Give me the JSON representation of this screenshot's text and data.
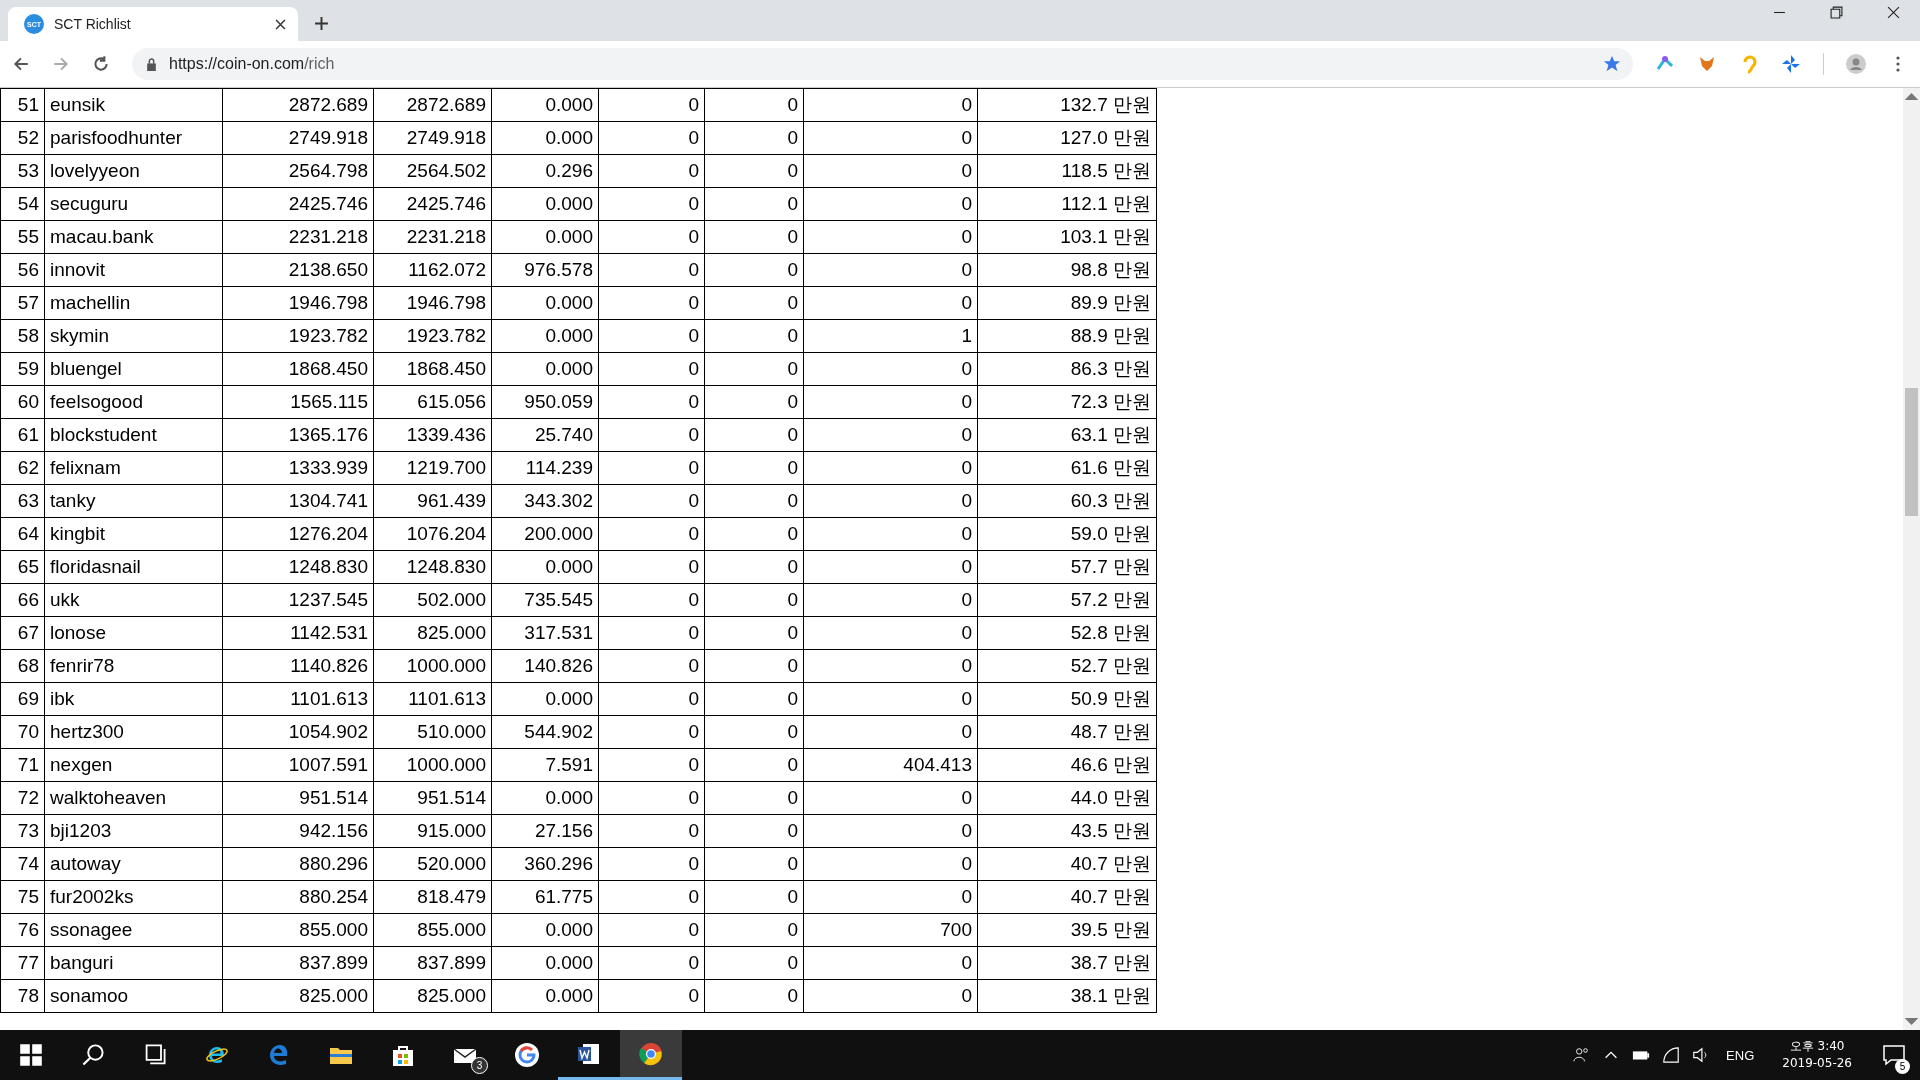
{
  "browser": {
    "tab_title": "SCT Richlist",
    "favicon_text": "SCT",
    "url_host": "https://coin-on.com",
    "url_path": "/rich"
  },
  "table": {
    "rows": [
      [
        "51",
        "eunsik",
        "2872.689",
        "2872.689",
        "0.000",
        "0",
        "0",
        "0",
        "132.7 만원"
      ],
      [
        "52",
        "parisfoodhunter",
        "2749.918",
        "2749.918",
        "0.000",
        "0",
        "0",
        "0",
        "127.0 만원"
      ],
      [
        "53",
        "lovelyyeon",
        "2564.798",
        "2564.502",
        "0.296",
        "0",
        "0",
        "0",
        "118.5 만원"
      ],
      [
        "54",
        "secuguru",
        "2425.746",
        "2425.746",
        "0.000",
        "0",
        "0",
        "0",
        "112.1 만원"
      ],
      [
        "55",
        "macau.bank",
        "2231.218",
        "2231.218",
        "0.000",
        "0",
        "0",
        "0",
        "103.1 만원"
      ],
      [
        "56",
        "innovit",
        "2138.650",
        "1162.072",
        "976.578",
        "0",
        "0",
        "0",
        "98.8 만원"
      ],
      [
        "57",
        "machellin",
        "1946.798",
        "1946.798",
        "0.000",
        "0",
        "0",
        "0",
        "89.9 만원"
      ],
      [
        "58",
        "skymin",
        "1923.782",
        "1923.782",
        "0.000",
        "0",
        "0",
        "1",
        "88.9 만원"
      ],
      [
        "59",
        "bluengel",
        "1868.450",
        "1868.450",
        "0.000",
        "0",
        "0",
        "0",
        "86.3 만원"
      ],
      [
        "60",
        "feelsogood",
        "1565.115",
        "615.056",
        "950.059",
        "0",
        "0",
        "0",
        "72.3 만원"
      ],
      [
        "61",
        "blockstudent",
        "1365.176",
        "1339.436",
        "25.740",
        "0",
        "0",
        "0",
        "63.1 만원"
      ],
      [
        "62",
        "felixnam",
        "1333.939",
        "1219.700",
        "114.239",
        "0",
        "0",
        "0",
        "61.6 만원"
      ],
      [
        "63",
        "tanky",
        "1304.741",
        "961.439",
        "343.302",
        "0",
        "0",
        "0",
        "60.3 만원"
      ],
      [
        "64",
        "kingbit",
        "1276.204",
        "1076.204",
        "200.000",
        "0",
        "0",
        "0",
        "59.0 만원"
      ],
      [
        "65",
        "floridasnail",
        "1248.830",
        "1248.830",
        "0.000",
        "0",
        "0",
        "0",
        "57.7 만원"
      ],
      [
        "66",
        "ukk",
        "1237.545",
        "502.000",
        "735.545",
        "0",
        "0",
        "0",
        "57.2 만원"
      ],
      [
        "67",
        "lonose",
        "1142.531",
        "825.000",
        "317.531",
        "0",
        "0",
        "0",
        "52.8 만원"
      ],
      [
        "68",
        "fenrir78",
        "1140.826",
        "1000.000",
        "140.826",
        "0",
        "0",
        "0",
        "52.7 만원"
      ],
      [
        "69",
        "ibk",
        "1101.613",
        "1101.613",
        "0.000",
        "0",
        "0",
        "0",
        "50.9 만원"
      ],
      [
        "70",
        "hertz300",
        "1054.902",
        "510.000",
        "544.902",
        "0",
        "0",
        "0",
        "48.7 만원"
      ],
      [
        "71",
        "nexgen",
        "1007.591",
        "1000.000",
        "7.591",
        "0",
        "0",
        "404.413",
        "46.6 만원"
      ],
      [
        "72",
        "walktoheaven",
        "951.514",
        "951.514",
        "0.000",
        "0",
        "0",
        "0",
        "44.0 만원"
      ],
      [
        "73",
        "bji1203",
        "942.156",
        "915.000",
        "27.156",
        "0",
        "0",
        "0",
        "43.5 만원"
      ],
      [
        "74",
        "autoway",
        "880.296",
        "520.000",
        "360.296",
        "0",
        "0",
        "0",
        "40.7 만원"
      ],
      [
        "75",
        "fur2002ks",
        "880.254",
        "818.479",
        "61.775",
        "0",
        "0",
        "0",
        "40.7 만원"
      ],
      [
        "76",
        "ssonagee",
        "855.000",
        "855.000",
        "0.000",
        "0",
        "0",
        "700",
        "39.5 만원"
      ],
      [
        "77",
        "banguri",
        "837.899",
        "837.899",
        "0.000",
        "0",
        "0",
        "0",
        "38.7 만원"
      ],
      [
        "78",
        "sonamoo",
        "825.000",
        "825.000",
        "0.000",
        "0",
        "0",
        "0",
        "38.1 만원"
      ]
    ]
  },
  "taskbar": {
    "mail_badge": "3",
    "language": "ENG",
    "time": "오후 3:40",
    "date": "2019-05-26",
    "notification_count": "5"
  }
}
